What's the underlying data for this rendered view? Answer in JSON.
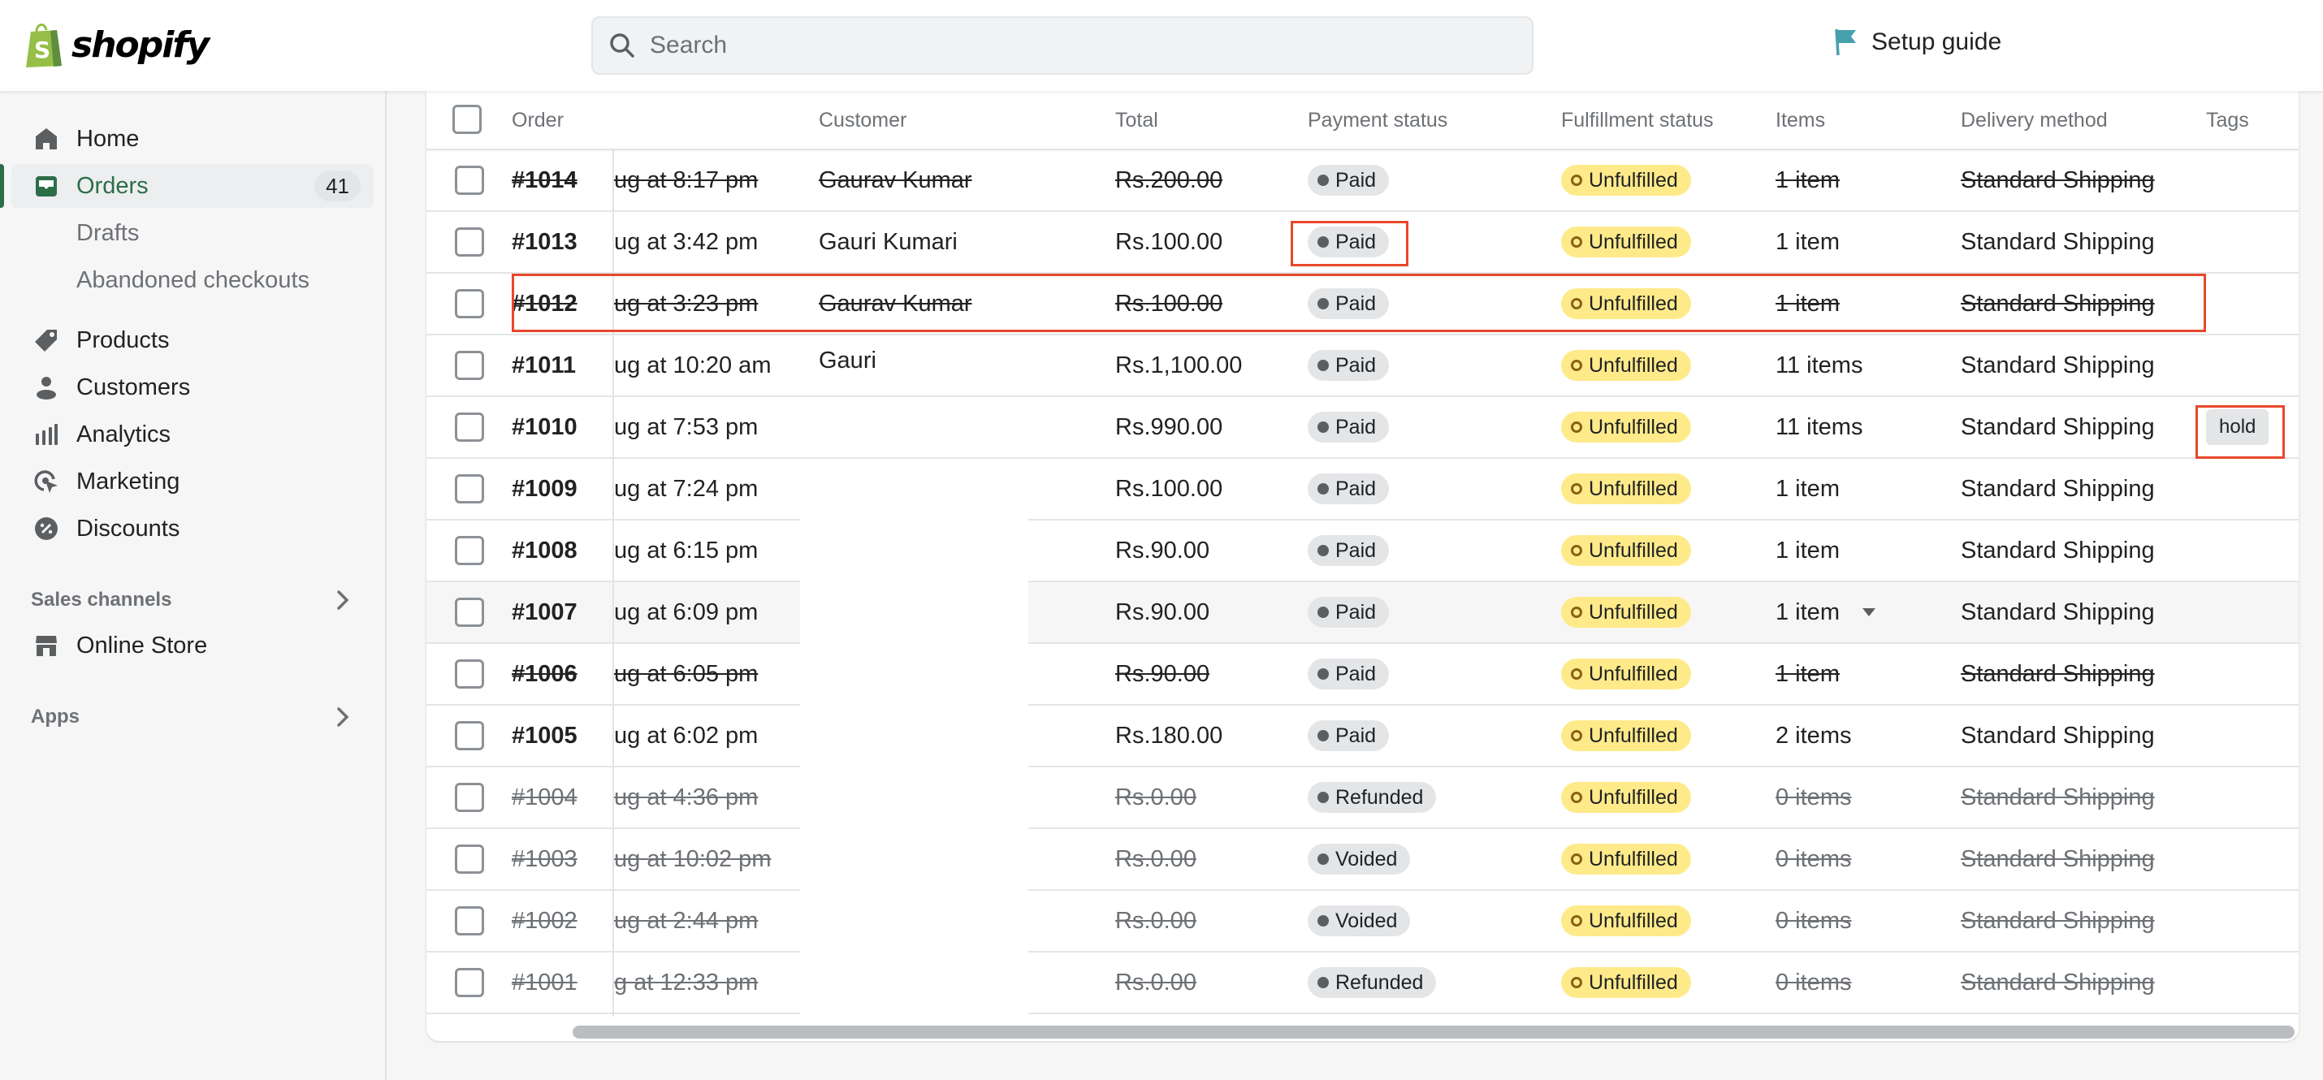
{
  "topbar": {
    "brand": "shopify",
    "search_placeholder": "Search",
    "setup_guide_label": "Setup guide",
    "colors": {
      "brand_green": "#95bf47",
      "flag": "#47a0ad"
    }
  },
  "sidebar": {
    "items": [
      {
        "label": "Home",
        "icon": "home-icon"
      },
      {
        "label": "Orders",
        "icon": "orders-icon",
        "count": "41",
        "active": true
      },
      {
        "label": "Drafts",
        "sub": true
      },
      {
        "label": "Abandoned checkouts",
        "sub": true
      },
      {
        "label": "Products",
        "icon": "tag-icon"
      },
      {
        "label": "Customers",
        "icon": "person-icon"
      },
      {
        "label": "Analytics",
        "icon": "bar-chart-icon"
      },
      {
        "label": "Marketing",
        "icon": "target-icon"
      },
      {
        "label": "Discounts",
        "icon": "discount-icon"
      }
    ],
    "sales_channels_label": "Sales channels",
    "online_store_label": "Online Store",
    "apps_label": "Apps",
    "accent_color": "#2c6e49"
  },
  "table": {
    "columns": [
      "Order",
      "Customer",
      "Total",
      "Payment status",
      "Fulfillment status",
      "Items",
      "Delivery method",
      "Tags"
    ],
    "rows": [
      {
        "order": "#1014",
        "date": "ug at 8:17 pm",
        "customer": "Gaurav Kumar",
        "total": "Rs.200.00",
        "payment": "Paid",
        "fulfillment": "Unfulfilled",
        "items": "1 item",
        "delivery": "Standard Shipping",
        "tags": "",
        "struck": true,
        "muted": false
      },
      {
        "order": "#1013",
        "date": "ug at 3:42 pm",
        "customer": "Gauri Kumari",
        "total": "Rs.100.00",
        "payment": "Paid",
        "fulfillment": "Unfulfilled",
        "items": "1 item",
        "delivery": "Standard Shipping",
        "tags": "",
        "struck": false,
        "muted": false
      },
      {
        "order": "#1012",
        "date": "ug at 3:23 pm",
        "customer": "Gaurav Kumar",
        "total": "Rs.100.00",
        "payment": "Paid",
        "fulfillment": "Unfulfilled",
        "items": "1 item",
        "delivery": "Standard Shipping",
        "tags": "",
        "struck": true,
        "muted": false
      },
      {
        "order": "#1011",
        "date": "ug at 10:20 am",
        "customer": "Gauri",
        "total": "Rs.1,100.00",
        "payment": "Paid",
        "fulfillment": "Unfulfilled",
        "items": "11 items",
        "delivery": "Standard Shipping",
        "tags": "",
        "struck": false,
        "muted": false
      },
      {
        "order": "#1010",
        "date": "ug at 7:53 pm",
        "customer": "",
        "total": "Rs.990.00",
        "payment": "Paid",
        "fulfillment": "Unfulfilled",
        "items": "11 items",
        "delivery": "Standard Shipping",
        "tags": "hold",
        "struck": false,
        "muted": false
      },
      {
        "order": "#1009",
        "date": "ug at 7:24 pm",
        "customer": "",
        "total": "Rs.100.00",
        "payment": "Paid",
        "fulfillment": "Unfulfilled",
        "items": "1 item",
        "delivery": "Standard Shipping",
        "tags": "",
        "struck": false,
        "muted": false
      },
      {
        "order": "#1008",
        "date": "ug at 6:15 pm",
        "customer": "",
        "total": "Rs.90.00",
        "payment": "Paid",
        "fulfillment": "Unfulfilled",
        "items": "1 item",
        "delivery": "Standard Shipping",
        "tags": "",
        "struck": false,
        "muted": false
      },
      {
        "order": "#1007",
        "date": "ug at 6:09 pm",
        "customer": "",
        "total": "Rs.90.00",
        "payment": "Paid",
        "fulfillment": "Unfulfilled",
        "items": "1 item",
        "delivery": "Standard Shipping",
        "tags": "",
        "struck": false,
        "muted": false,
        "hover": true,
        "items_dropdown": true
      },
      {
        "order": "#1006",
        "date": "ug at 6:05 pm",
        "customer": "",
        "total": "Rs.90.00",
        "payment": "Paid",
        "fulfillment": "Unfulfilled",
        "items": "1 item",
        "delivery": "Standard Shipping",
        "tags": "",
        "struck": true,
        "muted": false
      },
      {
        "order": "#1005",
        "date": "ug at 6:02 pm",
        "customer": "",
        "total": "Rs.180.00",
        "payment": "Paid",
        "fulfillment": "Unfulfilled",
        "items": "2 items",
        "delivery": "Standard Shipping",
        "tags": "",
        "struck": false,
        "muted": false
      },
      {
        "order": "#1004",
        "date": "ug at 4:36 pm",
        "customer": "",
        "total": "Rs.0.00",
        "payment": "Refunded",
        "fulfillment": "Unfulfilled",
        "items": "0 items",
        "delivery": "Standard Shipping",
        "tags": "",
        "struck": true,
        "muted": true
      },
      {
        "order": "#1003",
        "date": "ug at 10:02 pm",
        "customer": "",
        "total": "Rs.0.00",
        "payment": "Voided",
        "fulfillment": "Unfulfilled",
        "items": "0 items",
        "delivery": "Standard Shipping",
        "tags": "",
        "struck": true,
        "muted": true
      },
      {
        "order": "#1002",
        "date": "ug at 2:44 pm",
        "customer": "",
        "total": "Rs.0.00",
        "payment": "Voided",
        "fulfillment": "Unfulfilled",
        "items": "0 items",
        "delivery": "Standard Shipping",
        "tags": "",
        "struck": true,
        "muted": true
      },
      {
        "order": "#1001",
        "date": "g at 12:33 pm",
        "customer": "",
        "total": "Rs.0.00",
        "payment": "Refunded",
        "fulfillment": "Unfulfilled",
        "items": "0 items",
        "delivery": "Standard Shipping",
        "tags": "",
        "struck": true,
        "muted": true
      }
    ],
    "colors": {
      "payment_badge_bg": "#e4e5e7",
      "fulfillment_badge_bg": "#ffea8a",
      "annotation_red": "#e8472b"
    }
  }
}
